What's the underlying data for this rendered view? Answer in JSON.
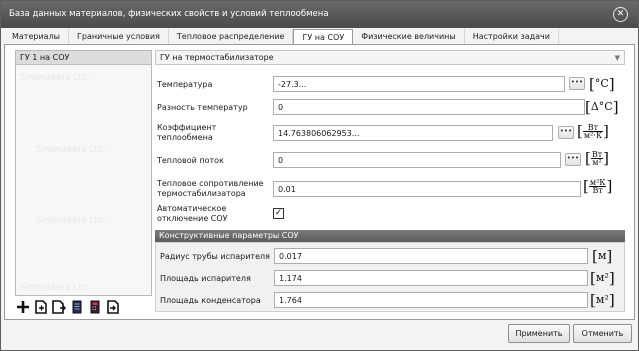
{
  "window": {
    "title": "База данных материалов, физических свойств и условий теплообмена"
  },
  "tabs": [
    {
      "label": "Материалы"
    },
    {
      "label": "Граничные условия"
    },
    {
      "label": "Тепловое распределение"
    },
    {
      "label": "ГУ на СОУ",
      "active": true
    },
    {
      "label": "Физические величины"
    },
    {
      "label": "Настройки задачи"
    }
  ],
  "list": {
    "items": [
      "ГУ 1 на СОУ"
    ],
    "watermark": "Simmakers Ltd."
  },
  "toolbar": {
    "icons": [
      "add-icon",
      "new-document-icon",
      "import-icon",
      "database-icon",
      "calculator-icon",
      "export-icon"
    ]
  },
  "type_select": {
    "value": "ГУ на термостабилизаторе"
  },
  "fields": {
    "temperature": {
      "label": "Температура",
      "value": "-27.3...",
      "unit": "°C"
    },
    "temp_diff": {
      "label": "Разность температур",
      "value": "0",
      "unit": "Δ°C"
    },
    "coef": {
      "label1": "Коэффициент",
      "label2": "теплообмена",
      "value": "14.763806062953...",
      "unit_num": "Вт",
      "unit_den": "м²·К"
    },
    "flux": {
      "label": "Тепловой поток",
      "value": "0",
      "unit_num": "Вт",
      "unit_den": "м²"
    },
    "resistance": {
      "label1": "Тепловое сопротивление",
      "label2": "термостабилизатора",
      "value": "0.01",
      "unit_num": "м²К",
      "unit_den": "Вт"
    },
    "auto_off": {
      "label1": "Автоматическое",
      "label2": "отключение СОУ",
      "checked": true,
      "mark": "✓"
    }
  },
  "group": {
    "title": "Конструктивные параметры СОУ",
    "radius": {
      "label": "Радиус трубы испарителя",
      "value": "0.017",
      "unit": "м"
    },
    "evap_area": {
      "label": "Площадь испарителя",
      "value": "1.174",
      "unit": "м²"
    },
    "cond_area": {
      "label": "Площадь конденсатора",
      "value": "1.764",
      "unit": "м²"
    }
  },
  "buttons": {
    "dots": "•••",
    "apply": "Применить",
    "cancel": "Отменить",
    "close": "✕"
  },
  "colors": {
    "titlebar": "#555555",
    "group_header": "#6b6b6b",
    "list_selected": "#dcdcdc"
  }
}
